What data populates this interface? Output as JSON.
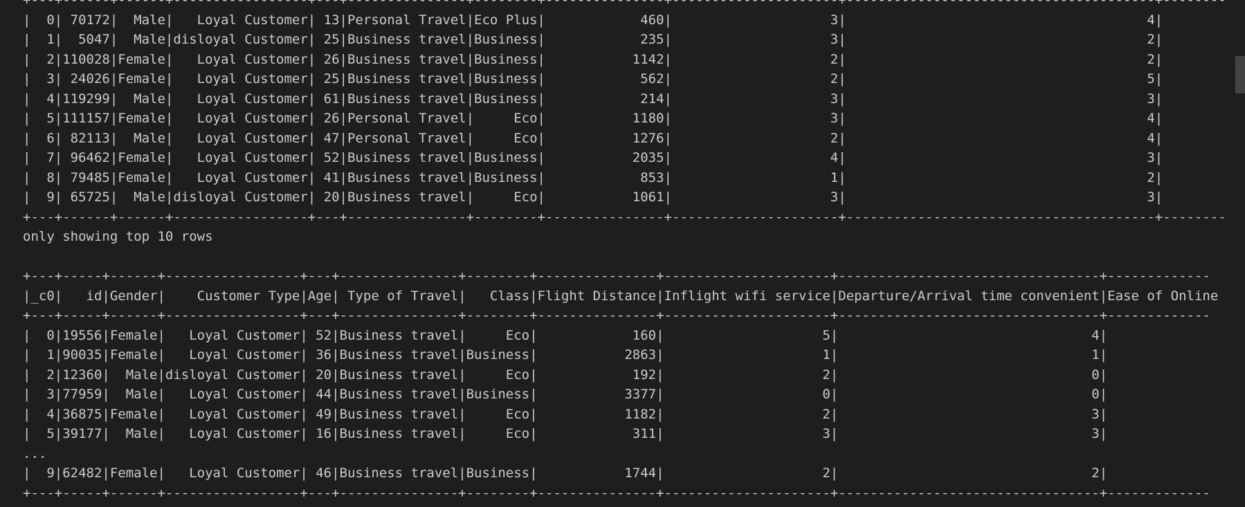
{
  "table1": {
    "border": "+---+------+------+-----------------+---+---------------+--------+---------------+---------------------+---------------------------------------+-------------",
    "rows": [
      "|  0| 70172|  Male|   Loyal Customer| 13|Personal Travel|Eco Plus|            460|                    3|                                      4|",
      "|  1|  5047|  Male|disloyal Customer| 25|Business travel|Business|            235|                    3|                                      2|",
      "|  2|110028|Female|   Loyal Customer| 26|Business travel|Business|           1142|                    2|                                      2|",
      "|  3| 24026|Female|   Loyal Customer| 25|Business travel|Business|            562|                    2|                                      5|",
      "|  4|119299|  Male|   Loyal Customer| 61|Business travel|Business|            214|                    3|                                      3|",
      "|  5|111157|Female|   Loyal Customer| 26|Personal Travel|     Eco|           1180|                    3|                                      4|",
      "|  6| 82113|  Male|   Loyal Customer| 47|Personal Travel|     Eco|           1276|                    2|                                      4|",
      "|  7| 96462|Female|   Loyal Customer| 52|Business travel|Business|           2035|                    4|                                      3|",
      "|  8| 79485|Female|   Loyal Customer| 41|Business travel|Business|            853|                    1|                                      2|",
      "|  9| 65725|  Male|disloyal Customer| 20|Business travel|     Eco|           1061|                    3|                                      3|"
    ]
  },
  "notice": "only showing top 10 rows",
  "table2": {
    "border": "+---+-----+------+-----------------+---+---------------+--------+---------------+---------------------+---------------------------------+-------------",
    "header": "|_c0|   id|Gender|    Customer Type|Age| Type of Travel|   Class|Flight Distance|Inflight wifi service|Departure/Arrival time convenient|Ease of Online",
    "rows": [
      "|  0|19556|Female|   Loyal Customer| 52|Business travel|     Eco|            160|                    5|                                4|",
      "|  1|90035|Female|   Loyal Customer| 36|Business travel|Business|           2863|                    1|                                1|",
      "|  2|12360|  Male|disloyal Customer| 20|Business travel|     Eco|            192|                    2|                                0|",
      "|  3|77959|  Male|   Loyal Customer| 44|Business travel|Business|           3377|                    0|                                0|",
      "|  4|36875|Female|   Loyal Customer| 49|Business travel|     Eco|           1182|                    2|                                3|",
      "|  5|39177|  Male|   Loyal Customer| 16|Business travel|     Eco|            311|                    3|                                3|"
    ],
    "ellipsis": "...",
    "rows_after": [
      "|  9|62482|Female|   Loyal Customer| 46|Business travel|Business|           1744|                    2|                                2|"
    ]
  }
}
